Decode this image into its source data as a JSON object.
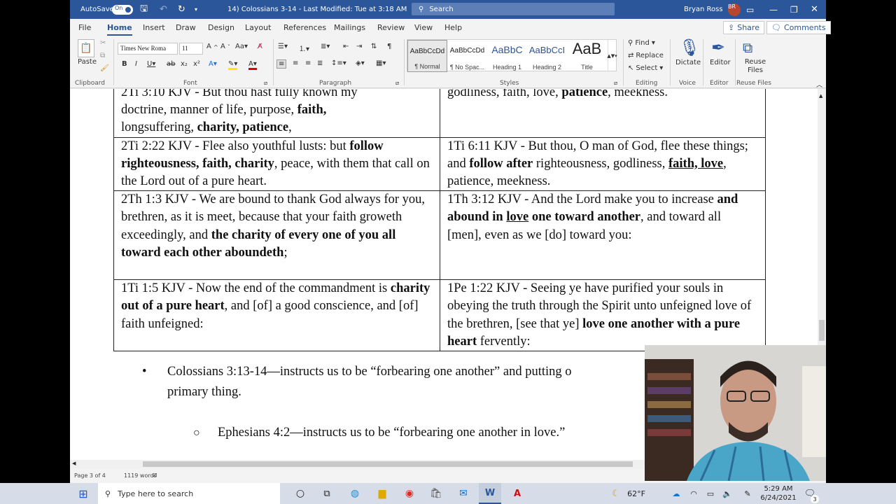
{
  "titlebar": {
    "autosave_label": "AutoSave",
    "autosave_state": "On",
    "doc_title": "14) Colossians 3-14 - Last Modified: Tue at 3:18 AM",
    "search_placeholder": "Search",
    "user_name": "Bryan Ross",
    "user_initials": "BR"
  },
  "menu": {
    "tabs": [
      "File",
      "Home",
      "Insert",
      "Draw",
      "Design",
      "Layout",
      "References",
      "Mailings",
      "Review",
      "View",
      "Help"
    ],
    "share_label": "Share",
    "comments_label": "Comments"
  },
  "ribbon": {
    "paste_label": "Paste",
    "clipboard_label": "Clipboard",
    "font_name": "Times New Roma",
    "font_size": "11",
    "font_label": "Font",
    "paragraph_label": "Paragraph",
    "styles": [
      {
        "preview": "AaBbCcDd",
        "name": "¶ Normal"
      },
      {
        "preview": "AaBbCcDd",
        "name": "¶ No Spac..."
      },
      {
        "preview": "AaBbC",
        "name": "Heading 1"
      },
      {
        "preview": "AaBbCcI",
        "name": "Heading 2"
      },
      {
        "preview": "AaB",
        "name": "Title"
      }
    ],
    "styles_label": "Styles",
    "find_label": "Find",
    "replace_label": "Replace",
    "select_label": "Select",
    "editing_label": "Editing",
    "dictate_label": "Dictate",
    "voice_label": "Voice",
    "editor_label": "Editor",
    "editor_group_label": "Editor",
    "reuse_label": "Reuse Files",
    "reuse_group_label": "Reuse Files"
  },
  "document": {
    "rows": [
      {
        "left": [
          [
            "",
            "2Ti 3:10 KJV - But thou hast fully known my"
          ],
          [
            "br",
            ""
          ],
          [
            "",
            "doctrine, manner of life, purpose, "
          ],
          [
            "b",
            "faith,"
          ],
          [
            "br",
            ""
          ],
          [
            "",
            "longsuffering, "
          ],
          [
            "b",
            "charity, patience"
          ],
          [
            "",
            ","
          ]
        ],
        "right": [
          [
            "",
            "godliness, faith, love, "
          ],
          [
            "b",
            "patience"
          ],
          [
            "",
            ", meekness."
          ]
        ]
      },
      {
        "left": [
          [
            "",
            "2Ti 2:22 KJV - Flee also youthful lusts: but "
          ],
          [
            "b",
            "follow righteousness, faith, charity"
          ],
          [
            "",
            ", peace, with them that call on the Lord out of a pure heart."
          ]
        ],
        "right": [
          [
            "",
            "1Ti 6:11 KJV - But thou, O man of God, flee these things; and "
          ],
          [
            "b",
            "follow after"
          ],
          [
            "",
            " righteousness, godliness, "
          ],
          [
            "bu",
            "faith, love"
          ],
          [
            "",
            ", patience, meekness."
          ]
        ]
      },
      {
        "left": [
          [
            "",
            "2Th 1:3 KJV - We are bound to thank God always for you, brethren, as it is meet, because that your faith groweth exceedingly, and "
          ],
          [
            "b",
            "the charity of every one of you all toward each other aboundeth"
          ],
          [
            "",
            ";"
          ]
        ],
        "right": [
          [
            "",
            "1Th 3:12 KJV - And the Lord make you to increase "
          ],
          [
            "b",
            "and abound in "
          ],
          [
            "bu",
            "love"
          ],
          [
            "b",
            " one toward another"
          ],
          [
            "",
            ", and toward all [men], even as we [do] toward you:"
          ]
        ]
      },
      {
        "left": [
          [
            "",
            "1Ti 1:5 KJV - Now the end of the commandment is "
          ],
          [
            "b",
            "charity out of a pure heart"
          ],
          [
            "",
            ", and [of] a good conscience, and [of] faith unfeigned:"
          ]
        ],
        "right": [
          [
            "",
            "1Pe 1:22 KJV - Seeing ye have purified your souls in obeying the truth through the Spirit unto unfeigned love of the brethren, [see that ye] "
          ],
          [
            "b",
            "love one another with a pure heart"
          ],
          [
            "",
            " fervently:"
          ]
        ]
      }
    ],
    "bullet1": "Colossians 3:13-14—instructs us to be “forbearing one another” and putting o",
    "bullet1_cont": "primary thing.",
    "bullet2": "Ephesians 4:2—instructs us to be “forbearing one another in love.”"
  },
  "status": {
    "page": "Page 3 of 4",
    "words": "1119 words"
  },
  "taskbar": {
    "search_placeholder": "Type here to search",
    "weather": "62°F",
    "time": "5:29 AM",
    "date": "6/24/2021",
    "notifications": "3"
  },
  "colors": {
    "word_blue": "#2b579a",
    "taskbar": "#d7dde8"
  }
}
